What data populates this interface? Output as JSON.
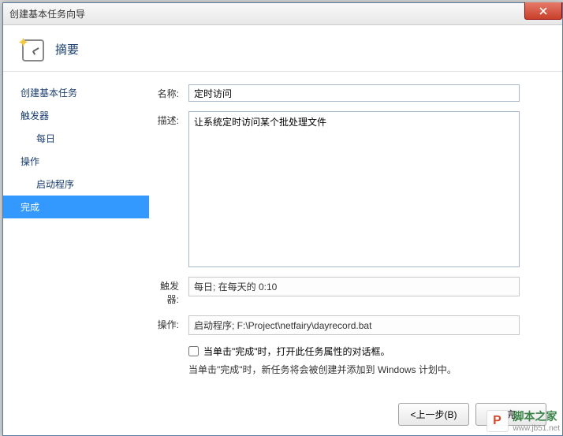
{
  "window": {
    "title": "创建基本任务向导"
  },
  "header": {
    "title": "摘要"
  },
  "sidebar": {
    "items": [
      {
        "label": "创建基本任务",
        "sub": false,
        "selected": false
      },
      {
        "label": "触发器",
        "sub": false,
        "selected": false
      },
      {
        "label": "每日",
        "sub": true,
        "selected": false
      },
      {
        "label": "操作",
        "sub": false,
        "selected": false
      },
      {
        "label": "启动程序",
        "sub": true,
        "selected": false
      },
      {
        "label": "完成",
        "sub": false,
        "selected": true
      }
    ]
  },
  "form": {
    "name_label": "名称:",
    "name_value": "定时访问",
    "desc_label": "描述:",
    "desc_value": "让系统定时访问某个批处理文件",
    "trigger_label": "触发器:",
    "trigger_value": "每日; 在每天的 0:10",
    "action_label": "操作:",
    "action_value": "启动程序; F:\\Project\\netfairy\\dayrecord.bat",
    "checkbox_label": "当单击\"完成\"时，打开此任务属性的对话框。",
    "info_text": "当单击\"完成\"时，新任务将会被创建并添加到 Windows 计划中。"
  },
  "buttons": {
    "back": "<上一步(B)",
    "finish": "完"
  },
  "watermark": {
    "logo": "P",
    "text": "脚本之家",
    "sub": "www.jb51.net"
  }
}
